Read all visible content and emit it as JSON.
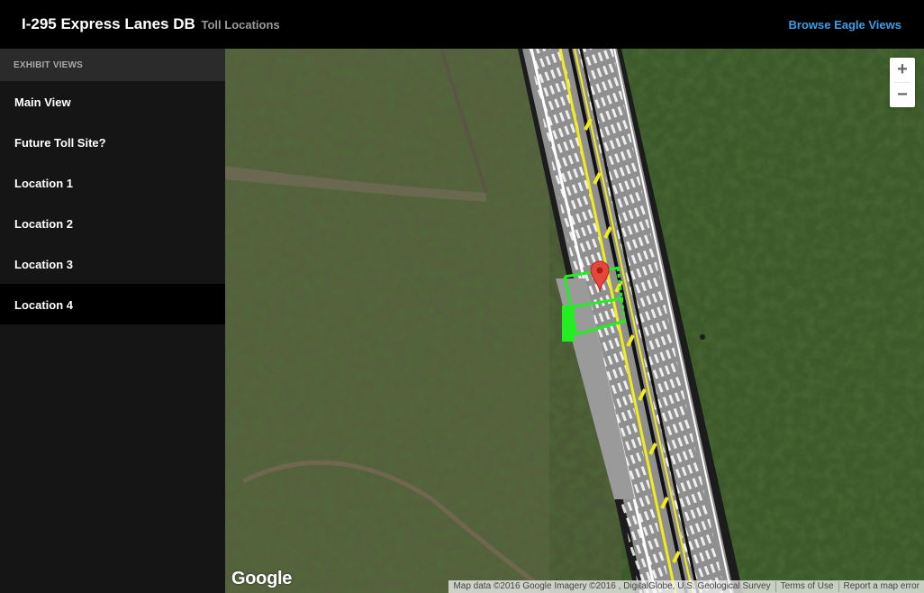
{
  "header": {
    "title": "I-295 Express Lanes DB",
    "subtitle": "Toll Locations",
    "browse_link": "Browse Eagle Views"
  },
  "sidebar": {
    "header": "EXHIBIT VIEWS",
    "items": [
      {
        "label": "Main View"
      },
      {
        "label": "Future Toll Site?"
      },
      {
        "label": "Location 1"
      },
      {
        "label": "Location 2"
      },
      {
        "label": "Location 3"
      },
      {
        "label": "Location 4"
      }
    ],
    "active": "Location 4"
  },
  "map": {
    "zoom_in": "+",
    "zoom_out": "−",
    "logo": "Google",
    "attribution": {
      "data": "Map data ©2016 Google Imagery ©2016 , DigitalGlobe, U.S. Geological Survey",
      "terms": "Terms of Use",
      "report": "Report a map error"
    },
    "marker_icon": "map-pin-icon",
    "colors": {
      "road": "#8f8f8f",
      "center_line": "#f2ec1b",
      "toll_structure": "#22ee22",
      "marker": "#e8463a"
    }
  }
}
